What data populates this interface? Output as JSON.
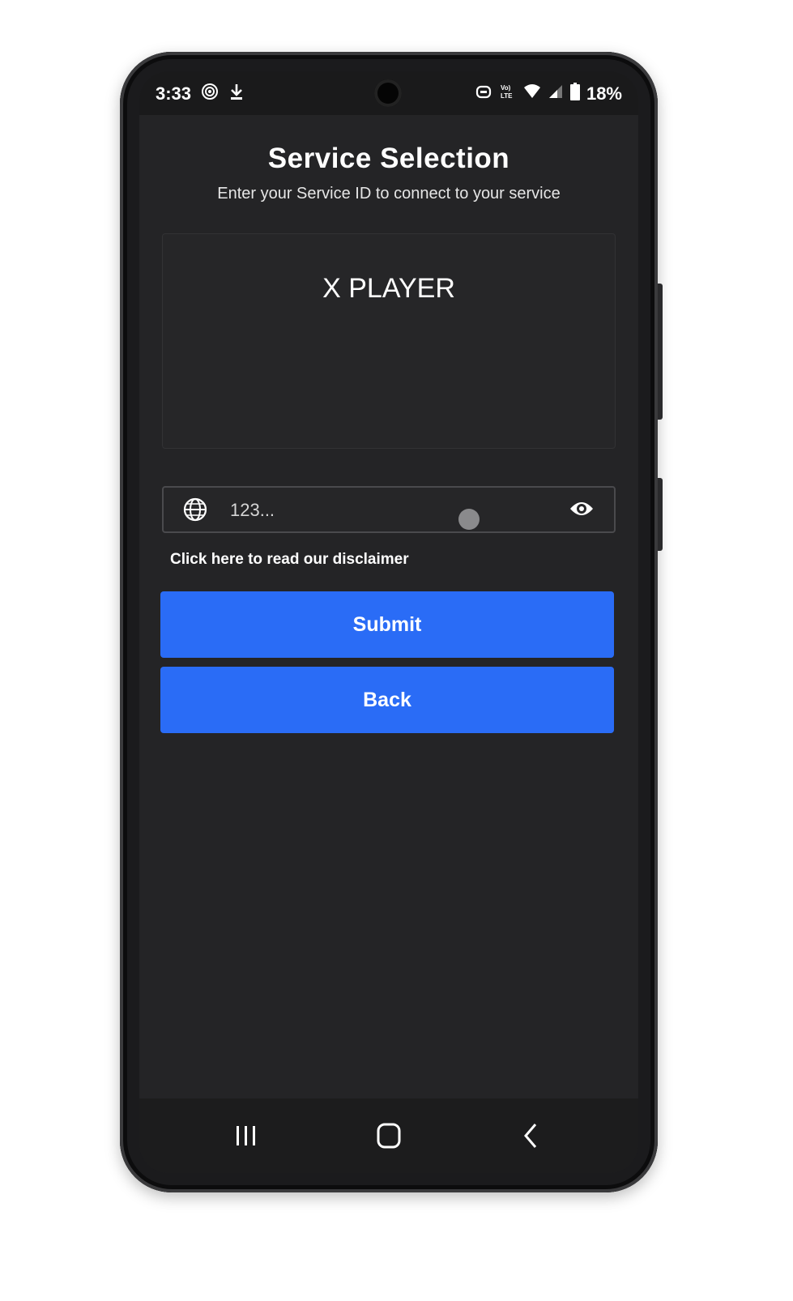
{
  "status_bar": {
    "time": "3:33",
    "battery": "18%",
    "network_label_top": "VoLTE",
    "network_label": "Vo) LTE"
  },
  "header": {
    "title": "Service Selection",
    "subtitle": "Enter your Service ID to connect to your service"
  },
  "logo": {
    "text": "X PLAYER"
  },
  "service_input": {
    "value": "123..."
  },
  "disclaimer_link": "Click here to read our disclaimer",
  "buttons": {
    "submit": "Submit",
    "back": "Back"
  },
  "colors": {
    "accent": "#2a6cf6",
    "background": "#242426"
  }
}
